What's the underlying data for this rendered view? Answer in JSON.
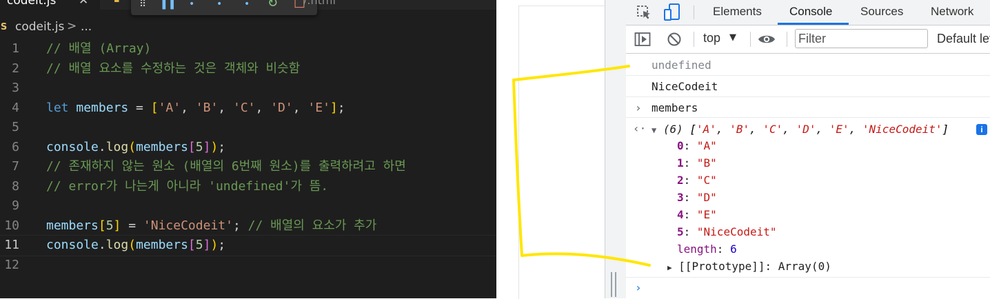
{
  "editor": {
    "tabs": [
      {
        "label": "codeit.js",
        "close": "✕"
      },
      {
        "label": ".html",
        "prefix": "/"
      }
    ],
    "breadcrumb": {
      "badge": "JS",
      "file": "codeit.js",
      "sep": ">",
      "more": "..."
    },
    "lines": [
      {
        "n": "1",
        "tokens": [
          {
            "t": "// 배열 (Array)",
            "c": "c-com"
          }
        ]
      },
      {
        "n": "2",
        "tokens": [
          {
            "t": "// 배열 요소를 수정하는 것은 객체와 비슷함",
            "c": "c-com"
          }
        ]
      },
      {
        "n": "3",
        "tokens": []
      },
      {
        "n": "4",
        "tokens": [
          {
            "t": "let",
            "c": "c-kw"
          },
          {
            "t": " ",
            "c": "c-op"
          },
          {
            "t": "members",
            "c": "c-var"
          },
          {
            "t": " = ",
            "c": "c-op"
          },
          {
            "t": "[",
            "c": "c-b1"
          },
          {
            "t": "'A'",
            "c": "c-str"
          },
          {
            "t": ", ",
            "c": "c-op"
          },
          {
            "t": "'B'",
            "c": "c-str"
          },
          {
            "t": ", ",
            "c": "c-op"
          },
          {
            "t": "'C'",
            "c": "c-str"
          },
          {
            "t": ", ",
            "c": "c-op"
          },
          {
            "t": "'D'",
            "c": "c-str"
          },
          {
            "t": ", ",
            "c": "c-op"
          },
          {
            "t": "'E'",
            "c": "c-str"
          },
          {
            "t": "]",
            "c": "c-b1"
          },
          {
            "t": ";",
            "c": "c-op"
          }
        ]
      },
      {
        "n": "5",
        "tokens": []
      },
      {
        "n": "6",
        "tokens": [
          {
            "t": "console",
            "c": "c-var"
          },
          {
            "t": ".",
            "c": "c-op"
          },
          {
            "t": "log",
            "c": "c-fn"
          },
          {
            "t": "(",
            "c": "c-b1"
          },
          {
            "t": "members",
            "c": "c-var"
          },
          {
            "t": "[",
            "c": "c-b2"
          },
          {
            "t": "5",
            "c": "c-num"
          },
          {
            "t": "]",
            "c": "c-b2"
          },
          {
            "t": ")",
            "c": "c-b1"
          },
          {
            "t": ";",
            "c": "c-op"
          }
        ]
      },
      {
        "n": "7",
        "tokens": [
          {
            "t": "// 존재하지 않는 원소 (배열의 6번째 원소)를 출력하려고 하면",
            "c": "c-com"
          }
        ]
      },
      {
        "n": "8",
        "tokens": [
          {
            "t": "// error가 나는게 아니라 'undefined'가 뜸.",
            "c": "c-com"
          }
        ]
      },
      {
        "n": "9",
        "tokens": []
      },
      {
        "n": "10",
        "tokens": [
          {
            "t": "members",
            "c": "c-var"
          },
          {
            "t": "[",
            "c": "c-b1"
          },
          {
            "t": "5",
            "c": "c-num"
          },
          {
            "t": "]",
            "c": "c-b1"
          },
          {
            "t": " = ",
            "c": "c-op"
          },
          {
            "t": "'NiceCodeit'",
            "c": "c-str"
          },
          {
            "t": "; ",
            "c": "c-op"
          },
          {
            "t": "// 배열의 요소가 추가",
            "c": "c-com"
          }
        ]
      },
      {
        "n": "11",
        "current": true,
        "tokens": [
          {
            "t": "console",
            "c": "c-var"
          },
          {
            "t": ".",
            "c": "c-op"
          },
          {
            "t": "log",
            "c": "c-fn"
          },
          {
            "t": "(",
            "c": "c-b1"
          },
          {
            "t": "members",
            "c": "c-var"
          },
          {
            "t": "[",
            "c": "c-b2"
          },
          {
            "t": "5",
            "c": "c-num"
          },
          {
            "t": "]",
            "c": "c-b2"
          },
          {
            "t": ")",
            "c": "c-b1"
          },
          {
            "t": ";",
            "c": "c-op"
          }
        ]
      },
      {
        "n": "12",
        "tokens": []
      }
    ]
  },
  "devtools": {
    "tabs": {
      "elements": "Elements",
      "console": "Console",
      "sources": "Sources",
      "network": "Network"
    },
    "toolbar": {
      "context": "top",
      "filter_placeholder": "Filter",
      "levels": "Default levels"
    },
    "console": {
      "log1": "undefined",
      "log2": "NiceCodeit",
      "input": "members",
      "array_summary": {
        "count": "(6)",
        "items": [
          "'A'",
          "'B'",
          "'C'",
          "'D'",
          "'E'",
          "'NiceCodeit'"
        ]
      },
      "entries": [
        {
          "key": "0",
          "value": "\"A\""
        },
        {
          "key": "1",
          "value": "\"B\""
        },
        {
          "key": "2",
          "value": "\"C\""
        },
        {
          "key": "3",
          "value": "\"D\""
        },
        {
          "key": "4",
          "value": "\"E\""
        },
        {
          "key": "5",
          "value": "\"NiceCodeit\""
        }
      ],
      "length_key": "length",
      "length_value": "6",
      "prototype_label": "[[Prototype]]",
      "prototype_value": "Array(0)"
    }
  },
  "colors": {
    "annotation": "#ffe600",
    "accent": "#1a73e8"
  }
}
